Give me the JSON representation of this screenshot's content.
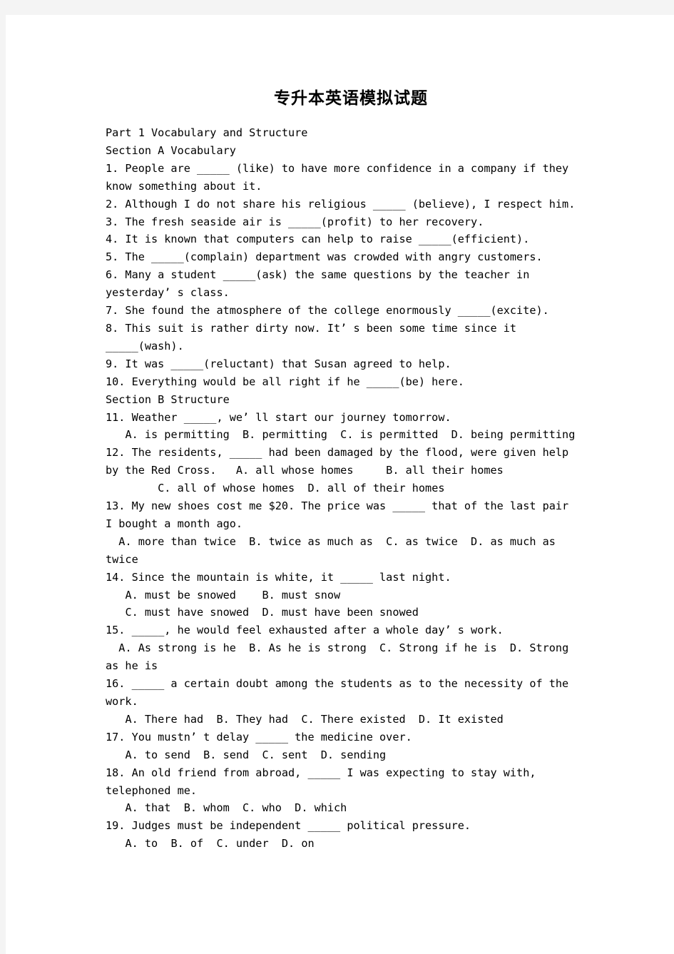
{
  "document": {
    "title": "专升本英语模拟试题",
    "lines": [
      "Part 1 Vocabulary and Structure",
      "Section A Vocabulary",
      "1. People are _____ (like) to have more confidence in a company if they",
      "know something about it.",
      "2. Although I do not share his religious _____ (believe), I respect him.",
      "3. The fresh seaside air is _____(profit) to her recovery.",
      "4. It is known that computers can help to raise _____(efficient).",
      "5. The _____(complain) department was crowded with angry customers.",
      "6. Many a student _____(ask) the same questions by the teacher in",
      "yesterday’ s class.",
      "7. She found the atmosphere of the college enormously _____(excite).",
      "8. This suit is rather dirty now. It’ s been some time since it",
      "_____(wash).",
      "9. It was _____(reluctant) that Susan agreed to help.",
      "10. Everything would be all right if he _____(be) here.",
      "Section B Structure",
      "11. Weather _____, we’ ll start our journey tomorrow.",
      "   A. is permitting  B. permitting  C. is permitted  D. being permitting",
      "12. The residents, _____ had been damaged by the flood, were given help",
      "by the Red Cross.   A. all whose homes     B. all their homes",
      "        C. all of whose homes  D. all of their homes",
      "13. My new shoes cost me $20. The price was _____ that of the last pair",
      "I bought a month ago.",
      "  A. more than twice  B. twice as much as  C. as twice  D. as much as",
      "twice",
      "14. Since the mountain is white, it _____ last night.",
      "   A. must be snowed    B. must snow",
      "   C. must have snowed  D. must have been snowed",
      "15. _____, he would feel exhausted after a whole day’ s work.",
      "  A. As strong is he  B. As he is strong  C. Strong if he is  D. Strong",
      "as he is",
      "16. _____ a certain doubt among the students as to the necessity of the",
      "work.",
      "   A. There had  B. They had  C. There existed  D. It existed",
      "17. You mustn’ t delay _____ the medicine over.",
      "   A. to send  B. send  C. sent  D. sending",
      "18. An old friend from abroad, _____ I was expecting to stay with,",
      "telephoned me.",
      "   A. that  B. whom  C. who  D. which",
      "19. Judges must be independent _____ political pressure.",
      "   A. to  B. of  C. under  D. on"
    ]
  }
}
